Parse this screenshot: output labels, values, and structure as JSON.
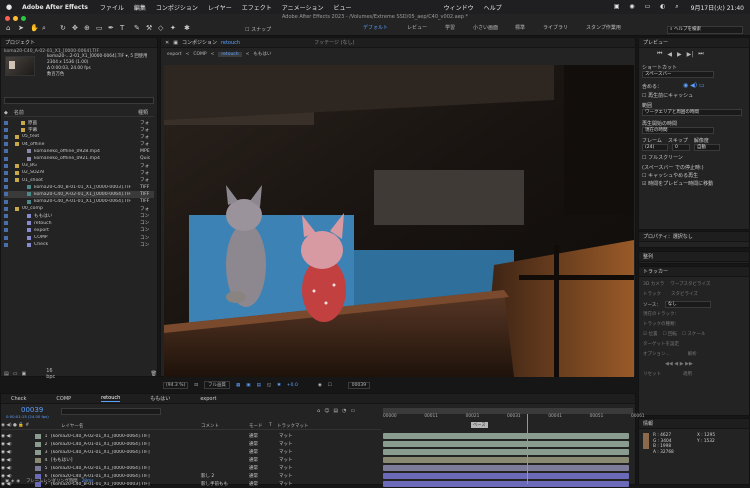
{
  "menubar": {
    "app": "Adobe After Effects",
    "items": [
      "ファイル",
      "編集",
      "コンポジション",
      "レイヤー",
      "エフェクト",
      "アニメーション",
      "ビュー",
      "ウィンドウ",
      "ヘルプ"
    ],
    "clock": "9月17日(火) 21:40"
  },
  "window_title": "Adobe After Effects 2023 - /Volumes/Extreme SSD/05_aep/C40_v002.aep *",
  "toolbar": {
    "snap": "スナップ",
    "workspaces": [
      "デフォルト",
      "レビュー",
      "学習",
      "小さい画面",
      "標準",
      "ライブラリ",
      "スタンプ作業用"
    ],
    "search": "ヘルプを検索"
  },
  "project": {
    "tab": "プロジェクト",
    "selected_name": "koma20-C40_A-02-01_X1_[0000-0064].TIF",
    "preview_name": "koma20-...2-01_X1_[0000-0064].TIF ▾, 5 回使用",
    "preview_info1": "2304 x 1536 (1.00)",
    "preview_info2": "Δ 0:00:03, 24.00 fps",
    "preview_info3": "数百万色",
    "col_name": "名前",
    "col_type": "種類",
    "items": [
      {
        "name": "原画",
        "type": "フォ",
        "color": "#c8a84b",
        "indent": 1
      },
      {
        "name": "字幕",
        "type": "フォ",
        "color": "#c8a84b",
        "indent": 1
      },
      {
        "name": "05_text",
        "type": "フォ",
        "color": "#c8a84b",
        "indent": 0
      },
      {
        "name": "04_offline",
        "type": "フォ",
        "color": "#c8a84b",
        "indent": 0
      },
      {
        "name": "komaneko_offline_0928.mp4",
        "type": "MPE",
        "color": "#8a8aa8",
        "indent": 2
      },
      {
        "name": "komaneko_offline_0921.mp4",
        "type": "Quic",
        "color": "#8a8aa8",
        "indent": 2
      },
      {
        "name": "03_BG",
        "type": "フォ",
        "color": "#c8a84b",
        "indent": 0
      },
      {
        "name": "02_SOZAI",
        "type": "フォ",
        "color": "#c8a84b",
        "indent": 0
      },
      {
        "name": "01_shoot",
        "type": "フォ",
        "color": "#c8a84b",
        "indent": 0
      },
      {
        "name": "koma20-C40_B-01-01_X1_[0000-0003].TIF",
        "type": "TIFF",
        "color": "#4a8a8a",
        "indent": 2
      },
      {
        "name": "koma20-C40_A-02-01_X1_[0000-0064].TIF",
        "type": "TIFF",
        "color": "#4a8a8a",
        "indent": 2,
        "selected": true
      },
      {
        "name": "koma20-C40_A-01-01_X1_[0000-0064].TIF",
        "type": "TIFF",
        "color": "#4a8a8a",
        "indent": 2
      },
      {
        "name": "00_comp",
        "type": "フォ",
        "color": "#c8a84b",
        "indent": 0
      },
      {
        "name": "ももはい",
        "type": "コン",
        "color": "#8a8ad0",
        "indent": 2
      },
      {
        "name": "retouch",
        "type": "コン",
        "color": "#8a8ad0",
        "indent": 2
      },
      {
        "name": "export",
        "type": "コン",
        "color": "#8a8ad0",
        "indent": 2
      },
      {
        "name": "COMP",
        "type": "コン",
        "color": "#8a8ad0",
        "indent": 2
      },
      {
        "name": "Check",
        "type": "コン",
        "color": "#8a8ad0",
        "indent": 2
      }
    ],
    "bpc": "16 bpc"
  },
  "viewer": {
    "tab": "コンポジション",
    "tab_name": "retouch",
    "footage_tab": "フッテージ (なし)",
    "breadcrumbs": [
      "export",
      "COMP",
      "retouch",
      "ももはい"
    ],
    "zoom": "(94.3 %)",
    "quality": "フル画質",
    "timecode": "00039",
    "exposure": "+0.0"
  },
  "preview": {
    "title": "プレビュー",
    "shortcut_label": "ショートカット",
    "shortcut": "スペースバー",
    "include_label": "含める：",
    "cache_before": "再生前にキャッシュ",
    "range_label": "範囲",
    "range": "ワークエリアと周囲の時間",
    "start_label": "再生開始の時間",
    "start": "現在の時間",
    "frame_label": "フレーム",
    "skip_label": "スキップ",
    "resolution_label": "解像度",
    "fps": "(24)",
    "skip": "0",
    "resolution": "自動",
    "fullscreen": "フルスクリーン",
    "stop_label": "(スペースバー での停止時:)",
    "cache_on_stop": "キャッシュやめる再生",
    "move_time": "時間をプレビュー時間に移動"
  },
  "properties": {
    "title": "プロパティ：選択なし"
  },
  "align": {
    "title": "整列"
  },
  "tracker": {
    "title": "トラッカー",
    "camera": "3D カメラ",
    "warp": "ワープスタビライズ",
    "track": "トラック",
    "stabilize": "スタビライズ",
    "source_label": "ソース：",
    "source": "なし",
    "current_track": "現在のトラック：",
    "track_type": "トラックの種類：",
    "position": "位置",
    "rotation": "回転",
    "scale": "スケール",
    "edit_target": "ターゲットを設定",
    "options": "オプション...",
    "analyze": "解析",
    "reset": "リセット",
    "apply": "適用"
  },
  "info": {
    "title": "情報",
    "r": "R : 4627",
    "g": "G : 3404",
    "b": "B : 1998",
    "a": "A : 32768",
    "x": "X : 1295",
    "y": "Y : 1532"
  },
  "timeline": {
    "tabs": [
      "Check",
      "COMP",
      "retouch",
      "ももはい",
      "export"
    ],
    "timecode": "00039",
    "sub": "0:00:01:15 (24.00 fps)",
    "col_layer": "レイヤー名",
    "col_comment": "コメント",
    "col_mode": "モード",
    "col_t": "T",
    "col_track": "トラックマット",
    "ruler": [
      "00000",
      "00011",
      "00021",
      "00031",
      "00041",
      "00051",
      "00061"
    ],
    "layers": [
      {
        "num": "1",
        "name": "[koma20-C40_A-02-01_X1_[0000-0064].TIF]",
        "comment": "",
        "mode": "通常",
        "track": "マット",
        "bar": "#8a9b8f",
        "start": 0.0,
        "end": 1.0
      },
      {
        "num": "2",
        "name": "[koma20-C40_A-01-01_X1_[0000-0064].TIF]",
        "comment": "",
        "mode": "通常",
        "track": "マット",
        "bar": "#8a9b8f",
        "start": 0.0,
        "end": 1.0
      },
      {
        "num": "3",
        "name": "[koma20-C40_A-01-01_X1_[0000-0064].TIF]",
        "comment": "",
        "mode": "通常",
        "track": "マット",
        "bar": "#8a9b8f",
        "start": 0.0,
        "end": 1.0
      },
      {
        "num": "4",
        "name": "[ももはい]",
        "comment": "",
        "mode": "通常",
        "track": "マット",
        "bar": "#8a8a72",
        "start": 0.0,
        "end": 1.0
      },
      {
        "num": "5",
        "name": "[koma20-C40_A-02-01_X1_[0000-0064].TIF]",
        "comment": "",
        "mode": "通常",
        "track": "マット",
        "bar": "#7c7c9a",
        "start": 0.0,
        "end": 1.0
      },
      {
        "num": "6",
        "name": "[koma20-C40_A-01-01_X1_[0000-0064].TIF]",
        "comment": "影し 2",
        "mode": "通常",
        "track": "マット",
        "bar": "#6a6ab8",
        "start": 0.0,
        "end": 1.0
      },
      {
        "num": "7",
        "name": "[koma20-C40_B-01-01_X1_[0000-0003].TIF]",
        "comment": "影し手前もも",
        "mode": "通常",
        "track": "マット",
        "bar": "#6a6ab8",
        "start": 0.0,
        "end": 1.0
      }
    ],
    "footer": "フレームレンダリング時間",
    "render_ms": "28ms",
    "marker": "ベース"
  }
}
